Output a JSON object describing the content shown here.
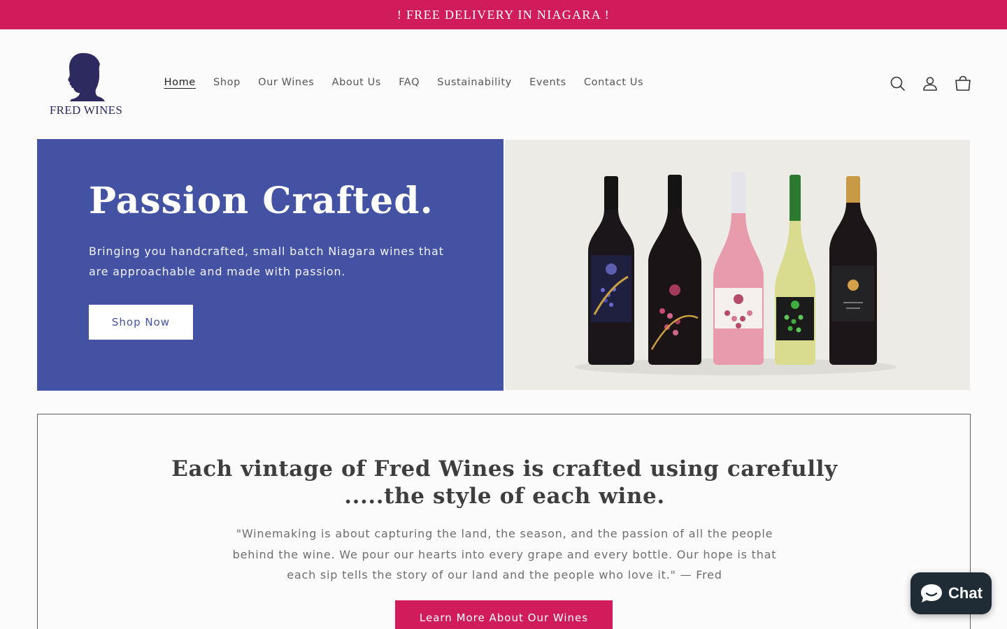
{
  "announcement": {
    "text": "! FREE DELIVERY IN NIAGARA !"
  },
  "header": {
    "logo_text": "FRED WINES",
    "nav": [
      {
        "label": "Home",
        "active": true
      },
      {
        "label": "Shop"
      },
      {
        "label": "Our Wines"
      },
      {
        "label": "About Us"
      },
      {
        "label": "FAQ"
      },
      {
        "label": "Sustainability"
      },
      {
        "label": "Events"
      },
      {
        "label": "Contact Us"
      }
    ],
    "icons": [
      "search-icon",
      "account-icon",
      "cart-icon"
    ]
  },
  "hero": {
    "title": "Passion Crafted.",
    "subtitle": "Bringing you handcrafted, small batch Niagara wines that are approachable and made with passion.",
    "button": "Shop Now",
    "background_color": "#4452a3"
  },
  "story": {
    "title": "Each vintage of Fred Wines is crafted using carefully .....the style of each wine.",
    "quote": "\"Winemaking is about capturing the land, the season, and the passion of all the people behind the wine. We pour our hearts into every grape and every bottle. Our hope is that each sip tells the story of our land and the people who love it.\" — Fred",
    "button": "Learn More About Our Wines"
  },
  "chat": {
    "label": "Chat"
  },
  "colors": {
    "accent": "#d01c5b",
    "hero_blue": "#4452a3",
    "logo_navy": "#2c2a5f",
    "chat_bg": "#1f2c36"
  }
}
